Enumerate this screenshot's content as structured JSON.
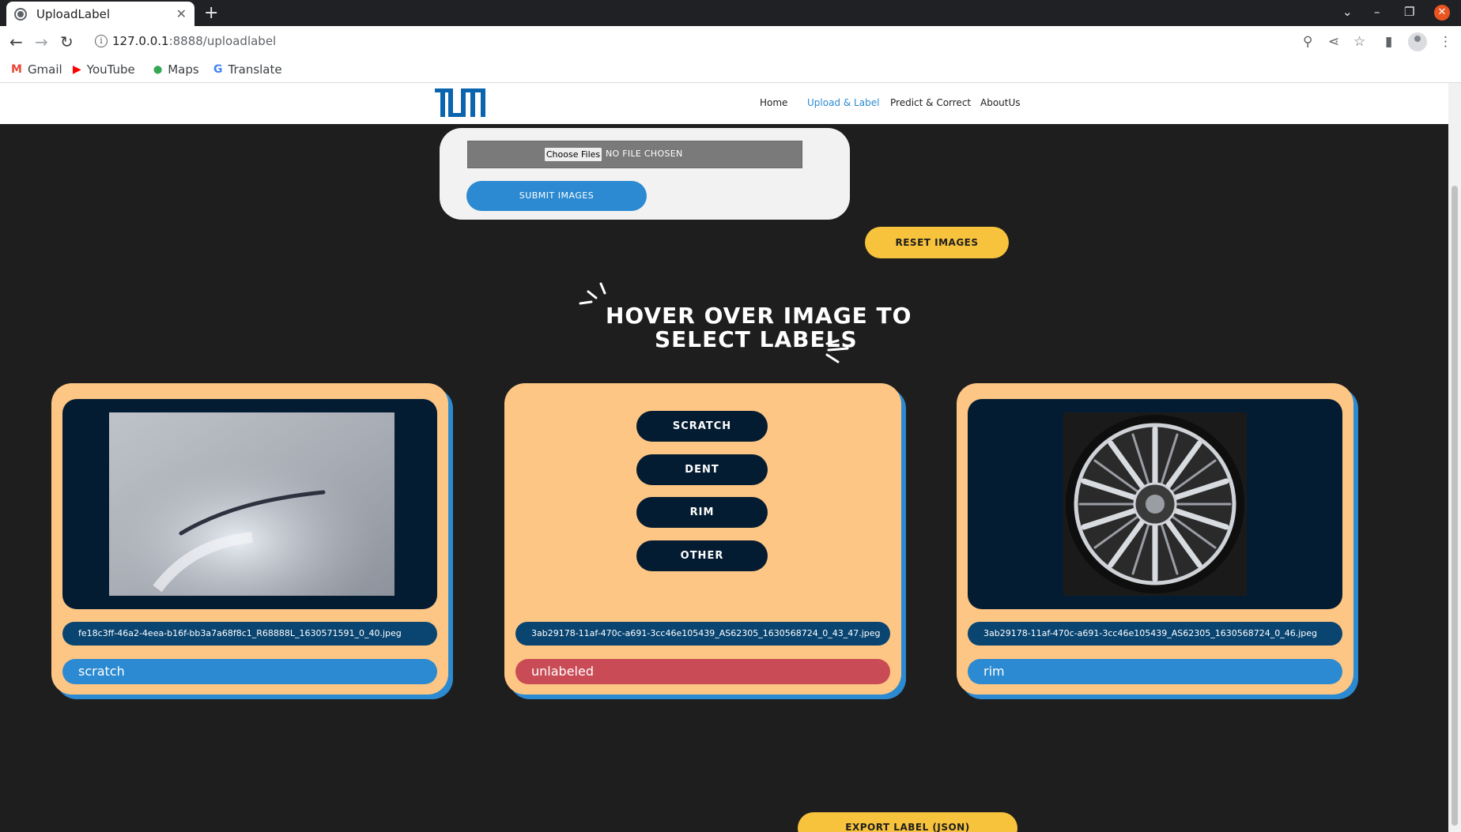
{
  "browser": {
    "tab_title": "UploadLabel",
    "tab_close": "✕",
    "new_tab": "+",
    "url_host": "127.0.0.1",
    "url_rest": ":8888/uploadlabel",
    "bookmarks": [
      {
        "label": "Gmail",
        "icon": "gmail-icon",
        "color": "#ea4335",
        "glyph": "M"
      },
      {
        "label": "YouTube",
        "icon": "youtube-icon",
        "color": "#ff0000",
        "glyph": "▶"
      },
      {
        "label": "Maps",
        "icon": "maps-icon",
        "color": "#34a853",
        "glyph": "⬤"
      },
      {
        "label": "Translate",
        "icon": "translate-icon",
        "color": "#4285f4",
        "glyph": "G"
      }
    ]
  },
  "site": {
    "nav": [
      {
        "label": "Home",
        "active": false
      },
      {
        "label": "Upload & Label",
        "active": true
      },
      {
        "label": "Predict & Correct",
        "active": false
      },
      {
        "label": "AboutUs",
        "active": false
      }
    ],
    "upload": {
      "choose_files": "Choose Files",
      "no_file": "NO FILE CHOSEN",
      "submit": "SUBMIT IMAGES"
    },
    "reset": "RESET IMAGES",
    "headline_line1": "HOVER OVER IMAGE TO",
    "headline_line2": "SELECT LABELS",
    "label_options": [
      "SCRATCH",
      "DENT",
      "RIM",
      "OTHER"
    ],
    "cards": [
      {
        "filename": "fe18c3ff-46a2-4eea-b16f-bb3a7a68f8c1_R68888L_1630571591_0_40.jpeg",
        "label": "scratch",
        "state": "labeled",
        "image": "scratch-photo"
      },
      {
        "filename": "3ab29178-11af-470c-a691-3cc46e105439_AS62305_1630568724_0_43_47.jpeg",
        "label": "unlabeled",
        "state": "unlabeled",
        "image": "hovered-label-menu"
      },
      {
        "filename": "3ab29178-11af-470c-a691-3cc46e105439_AS62305_1630568724_0_46.jpeg",
        "label": "rim",
        "state": "labeled",
        "image": "rim-photo"
      }
    ],
    "export": "EXPORT LABEL (JSON)"
  },
  "colors": {
    "accent_blue": "#2b8ad1",
    "card_bg": "#fec684",
    "image_frame": "#041c32",
    "filename_bg": "#0a4571",
    "unlabeled_red": "#c84b56",
    "yellow_button": "#f8c33c",
    "page_bg": "#1e1e1e"
  }
}
